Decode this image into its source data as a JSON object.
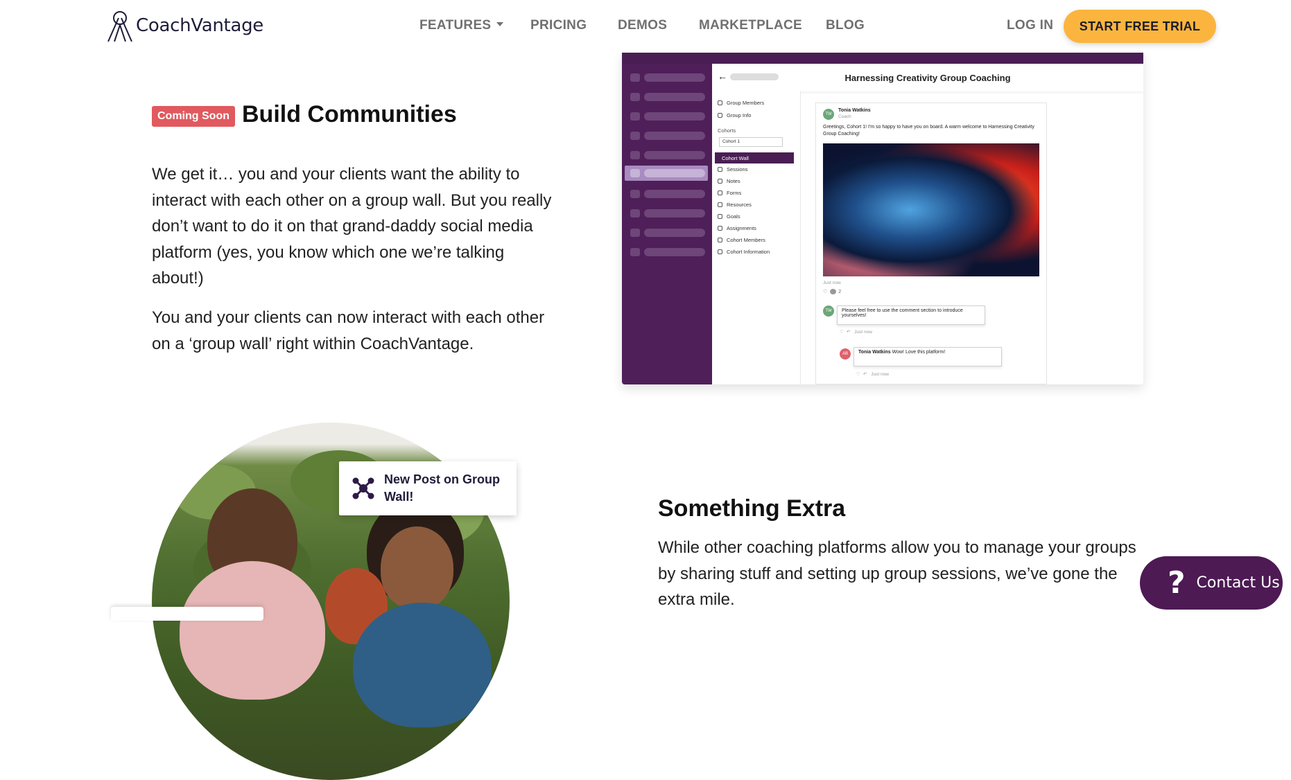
{
  "nav": {
    "logo": "CoachVantage",
    "items": [
      "FEATURES",
      "PRICING",
      "DEMOS",
      "MARKETPLACE",
      "BLOG"
    ],
    "login": "LOG IN",
    "cta": "START FREE TRIAL"
  },
  "section1": {
    "badge": "Coming Soon",
    "heading": "Build Communities",
    "p1": "We get it… you and your clients want the ability to interact with each other on a group wall. But you really don’t want to do it on that grand-daddy social media platform (yes, you know which one we’re talking about!)",
    "p2": "You and your clients can now interact with each other on a ‘group wall’ right within CoachVantage."
  },
  "app": {
    "title": "Harnessing Creativity Group Coaching",
    "menu": {
      "group_members": "Group Members",
      "group_info": "Group Info",
      "cohorts": "Cohorts",
      "cohort_select": "Cohort 1",
      "active": "Cohort Wall",
      "items": [
        "Sessions",
        "Notes",
        "Forms",
        "Resources",
        "Goals",
        "Assignments",
        "Cohort Members",
        "Cohort Information"
      ]
    },
    "post": {
      "author_initials": "TW",
      "author": "Tonia Watkins",
      "role": "Coach",
      "text": "Greetings, Cohort 1! I'm so happy to have you on board. A warm welcome to Harnessing Creativity Group Coaching!",
      "time": "Just now",
      "comment_count": "2",
      "comment1": "Please feel free to use the comment section to introduce yourselves!",
      "comment1_time": "Just now",
      "reply_initials": "AB",
      "reply_author": "Tonia Watkins",
      "reply_text": "Wow! Love this platform!",
      "reply_time": "Just now"
    }
  },
  "section2": {
    "notification": "New Post on Group Wall!",
    "heading": "Something Extra",
    "p1": "While other coaching platforms allow you to manage your groups by sharing stuff and setting up group sessions, we’ve gone the extra mile."
  },
  "contact": {
    "label": "Contact Us"
  },
  "colors": {
    "accent": "#fbb53f",
    "brand_purple": "#4d1a54",
    "badge": "#e05a5f"
  }
}
